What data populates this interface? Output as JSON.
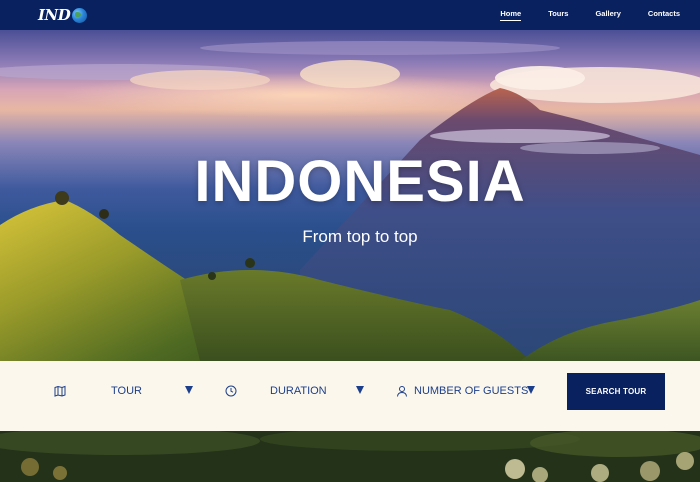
{
  "header": {
    "logo_text": "IND",
    "logo_icon": "globe-icon",
    "nav": [
      {
        "label": "Home",
        "active": true
      },
      {
        "label": "Tours",
        "active": false
      },
      {
        "label": "Gallery",
        "active": false
      },
      {
        "label": "Contacts",
        "active": false
      }
    ]
  },
  "hero": {
    "title": "INDONESIA",
    "subtitle": "From top to top"
  },
  "search": {
    "fields": [
      {
        "label": "TOUR",
        "icon": "map-icon"
      },
      {
        "label": "DURATION",
        "icon": "clock-icon"
      },
      {
        "label": "NUMBER OF GUESTS",
        "icon": "user-icon"
      }
    ],
    "button_label": "SEARCH TOUR"
  },
  "colors": {
    "nav_bg": "#0a2160",
    "accent": "#1c3f8c",
    "search_bg": "#fbf7ec"
  }
}
